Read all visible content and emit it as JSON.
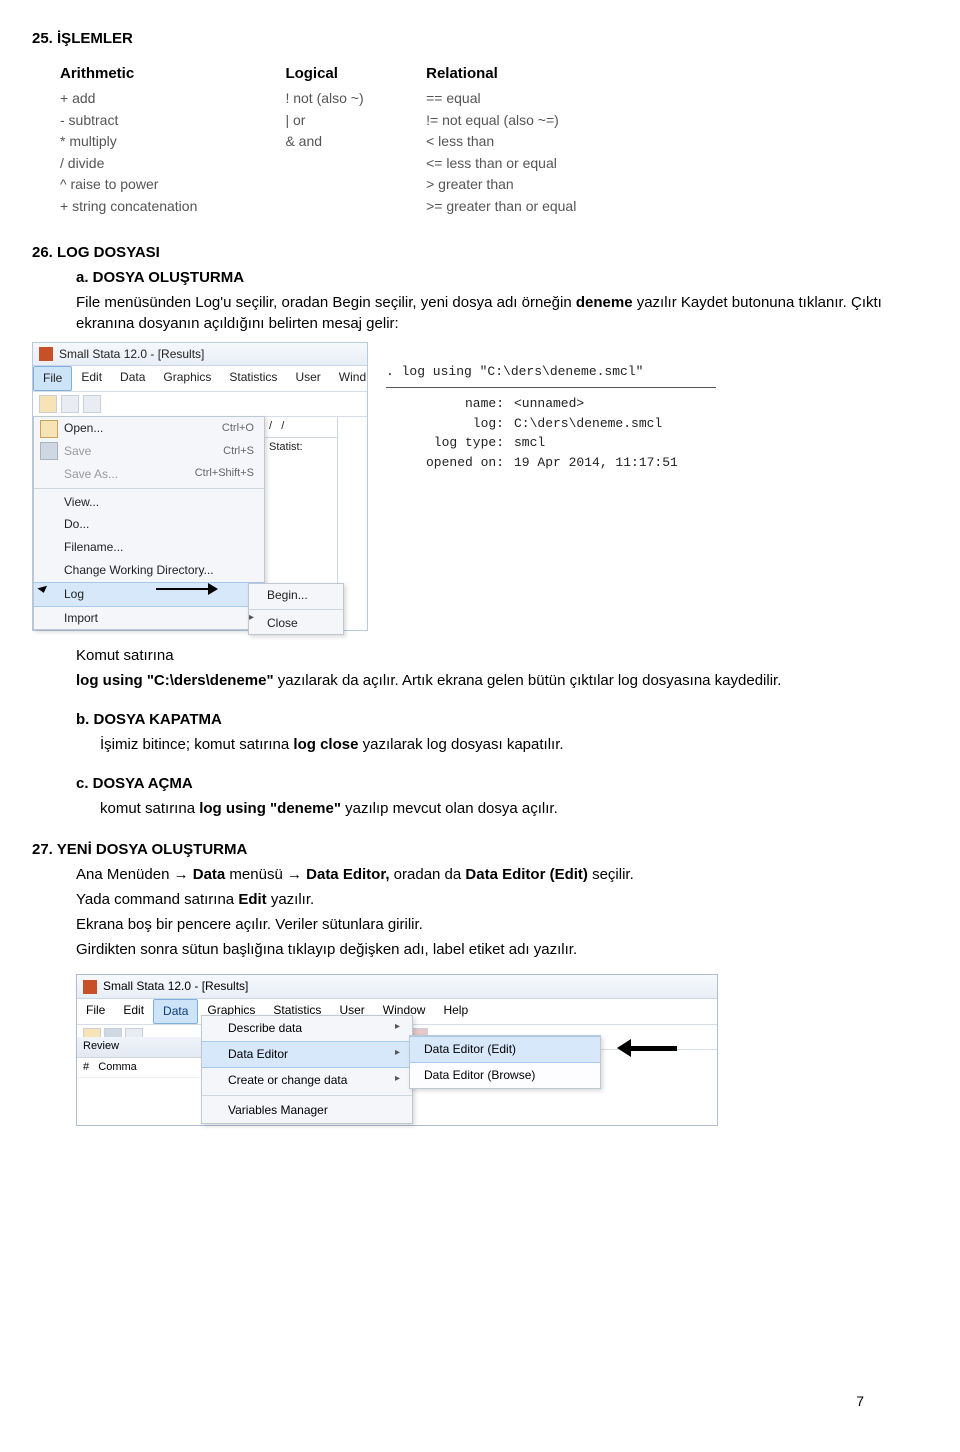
{
  "s25": {
    "title": "25. İŞLEMLER"
  },
  "ops": {
    "headers": [
      "Arithmetic",
      "Logical",
      "Relational"
    ],
    "rows": [
      [
        "+ add",
        "! not (also ~)",
        "== equal"
      ],
      [
        "- subtract",
        "| or",
        "!= not equal (also ~=)"
      ],
      [
        "* multiply",
        "& and",
        "< less than"
      ],
      [
        "/ divide",
        "",
        "<= less than or equal"
      ],
      [
        "^ raise to power",
        "",
        "> greater than"
      ],
      [
        "+ string concatenation",
        "",
        ">= greater than or equal"
      ]
    ]
  },
  "s26": {
    "title": "26. LOG DOSYASI",
    "a_label": "a.  DOSYA OLUŞTURMA",
    "a_body_1": "File menüsünden Log'u seçilir, oradan Begin seçilir, yeni dosya adı örneğin ",
    "a_body_1b": "deneme",
    "a_body_1c": " yazılır Kaydet butonuna tıklanır. Çıktı ekranına dosyanın açıldığını belirten mesaj gelir:",
    "after_shot_1": "Komut satırına",
    "after_shot_2a": "log using \"C:\\ders\\deneme\"",
    "after_shot_2b": " yazılarak da açılır. Artık ekrana gelen bütün çıktılar log dosyasına kaydedilir.",
    "b_label": "b.  DOSYA KAPATMA",
    "b_body_a": "İşimiz bitince; komut satırına  ",
    "b_body_b": "log close",
    "b_body_c": " yazılarak log dosyası kapatılır.",
    "c_label": "c.  DOSYA AÇMA",
    "c_body_a": "komut satırına  ",
    "c_body_b": "log using \"deneme\"",
    "c_body_c": " yazılıp mevcut olan dosya açılır."
  },
  "s27": {
    "title": "27. YENİ DOSYA OLUŞTURMA",
    "l1a": "Ana Menüden → ",
    "l1b": "Data",
    "l1c": " menüsü → ",
    "l1d": "Data Editor,",
    "l1e": " oradan da  ",
    "l1f": "Data Editor (Edit)",
    "l1g": " seçilir.",
    "l2a": "Yada command satırına ",
    "l2b": "Edit",
    "l2c": " yazılır.",
    "l3": "Ekrana boş bir pencere açılır. Veriler sütunlara girilir.",
    "l4": "Girdikten sonra sütun başlığına tıklayıp değişken adı, label etiket adı yazılır."
  },
  "shot1": {
    "title": "Small Stata 12.0 - [Results]",
    "menus": [
      "File",
      "Edit",
      "Data",
      "Graphics",
      "Statistics",
      "User",
      "Wind"
    ],
    "items": {
      "open": "Open...",
      "open_sc": "Ctrl+O",
      "save": "Save",
      "save_sc": "Ctrl+S",
      "saveas": "Save As...",
      "saveas_sc": "Ctrl+Shift+S",
      "view": "View...",
      "do": "Do...",
      "filename": "Filename...",
      "cwd": "Change Working Directory...",
      "log": "Log",
      "import": "Import"
    },
    "submenu": {
      "begin": "Begin...",
      "close": "Close"
    },
    "side": {
      "hdr1": "/",
      "hdr2": "/",
      "statist": "Statist:"
    },
    "logcmd": ". log using \"C:\\ders\\deneme.smcl\"",
    "kv": {
      "name_k": "name:",
      "name_v": "<unnamed>",
      "log_k": "log:",
      "log_v": "C:\\ders\\deneme.smcl",
      "type_k": "log type:",
      "type_v": "smcl",
      "opened_k": "opened on:",
      "opened_v": "19 Apr 2014, 11:17:51"
    }
  },
  "shot2": {
    "title": "Small Stata 12.0 - [Results]",
    "menus": [
      "File",
      "Edit",
      "Data",
      "Graphics",
      "Statistics",
      "User",
      "Window",
      "Help"
    ],
    "left": {
      "review": "Review",
      "hash": "#",
      "comma": "Comma"
    },
    "dd": {
      "describe": "Describe data",
      "editor": "Data Editor",
      "create": "Create or change data",
      "varmgr": "Variables Manager"
    },
    "sub": {
      "edit": "Data Editor (Edit)",
      "browse": "Data Editor (Browse)"
    }
  },
  "page_no": "7"
}
